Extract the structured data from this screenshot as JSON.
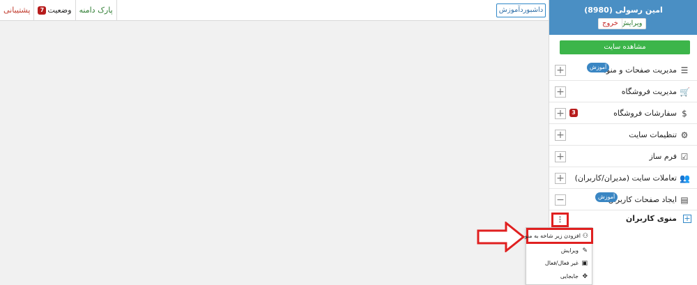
{
  "topbar": {
    "support_label": "پشتیبانی",
    "status_label": "وضعیت",
    "status_badge": "7",
    "park_label": "پارک دامنه",
    "dashboard_button": "داشبوردآموزش"
  },
  "user": {
    "name": "امین رسولی (8980)",
    "edit_label": "ویرایش",
    "exit_label": "خروج"
  },
  "site_view_label": "مشاهده سایت",
  "menu": {
    "items": [
      {
        "label": "مدیریت صفحات و منوها",
        "icon": "list-icon",
        "badge": "آموزش",
        "toggle": "+"
      },
      {
        "label": "مدیریت فروشگاه",
        "icon": "cart-icon",
        "toggle": "+"
      },
      {
        "label": "سفارشات فروشگاه",
        "icon": "dollar-icon",
        "count": "3",
        "toggle": "+"
      },
      {
        "label": "تنظیمات سایت",
        "icon": "gear-icon",
        "toggle": "+"
      },
      {
        "label": "فرم ساز",
        "icon": "checkbox-icon",
        "toggle": "+"
      },
      {
        "label": "تعاملات سایت (مدیران/کاربران)",
        "icon": "users-icon",
        "toggle": "+"
      },
      {
        "label": "ایجاد صفحات کاربران",
        "icon": "page-icon",
        "badge": "آموزش",
        "toggle": "−"
      }
    ]
  },
  "user_menu": {
    "label": "منوی کاربران",
    "plus": "+",
    "kebab": "⋮"
  },
  "dropdown": {
    "add_submenu": "افزودن زیر شاخه به منو",
    "edit": "ویرایش",
    "toggle_active": "غیر فعال/فعال",
    "move": "جابجایی"
  },
  "colors": {
    "header_blue": "#4a8fc4",
    "green_button": "#3cb54a",
    "highlight_red": "#e02020",
    "badge_blue": "#3a86c3"
  }
}
